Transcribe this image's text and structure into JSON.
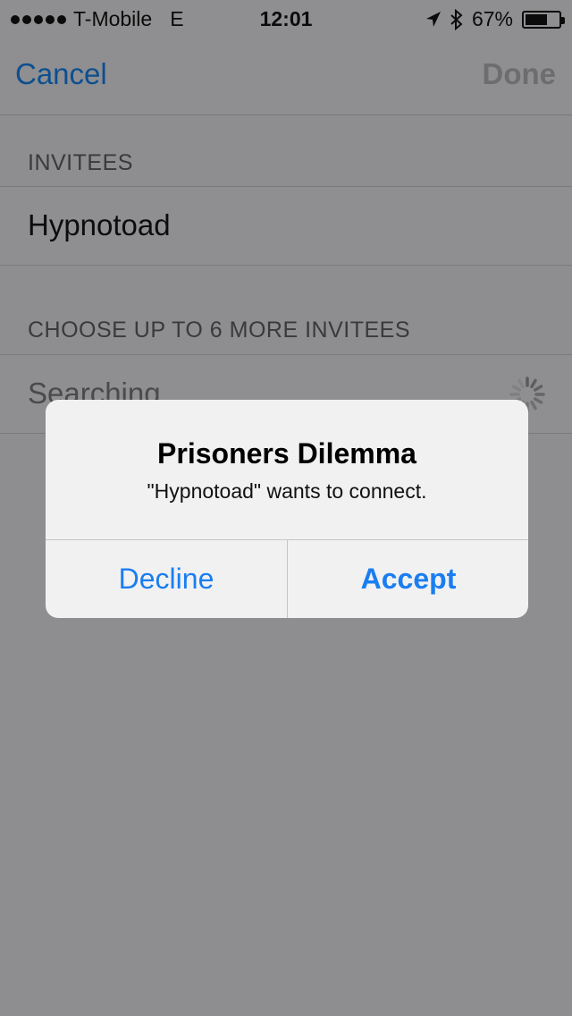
{
  "status_bar": {
    "carrier": "T-Mobile",
    "network": "E",
    "time": "12:01",
    "battery_text": "67%",
    "battery_level": 0.67
  },
  "nav": {
    "cancel_label": "Cancel",
    "done_label": "Done"
  },
  "sections": {
    "invitees_header": "INVITEES",
    "invitee_name": "Hypnotoad",
    "more_header": "CHOOSE UP TO 6 MORE INVITEES",
    "searching_label": "Searching"
  },
  "alert": {
    "title": "Prisoners Dilemma",
    "message": "\"Hypnotoad\" wants to connect.",
    "decline_label": "Decline",
    "accept_label": "Accept"
  },
  "colors": {
    "accent": "#1a7ef0",
    "dim_background": "#8e8e90"
  }
}
